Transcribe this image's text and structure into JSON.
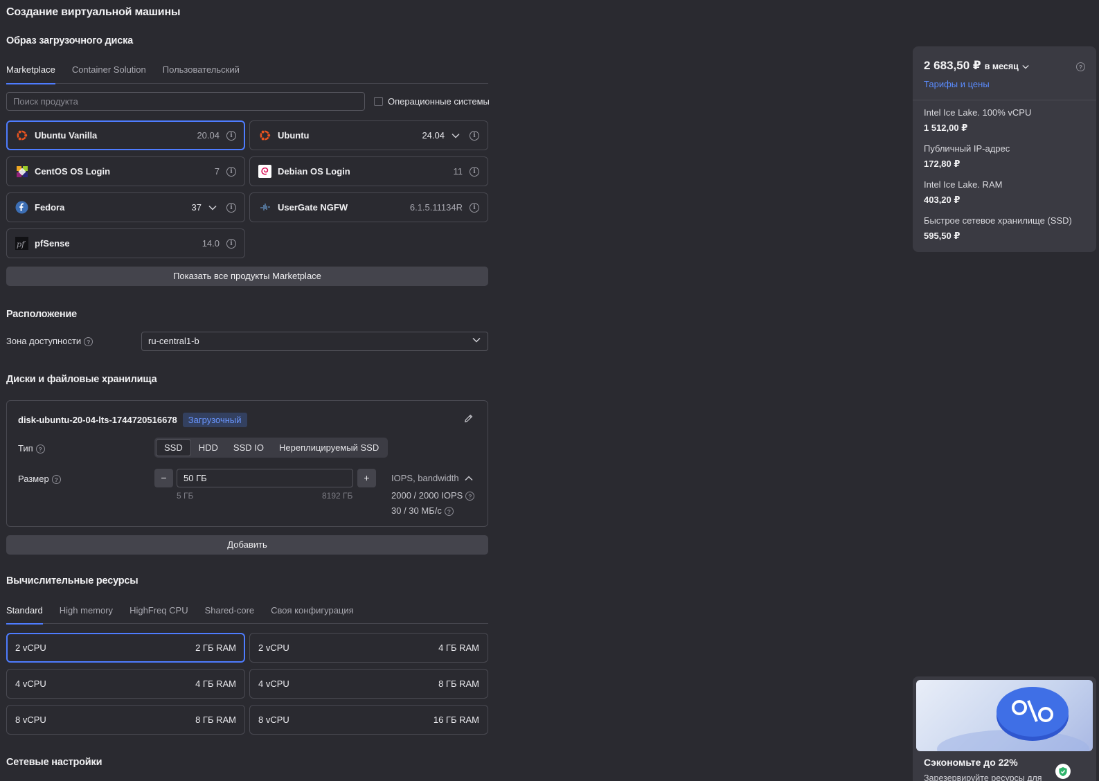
{
  "page_title": "Создание виртуальной машины",
  "boot_disk": {
    "heading": "Образ загрузочного диска",
    "tabs": [
      "Marketplace",
      "Container Solution",
      "Пользовательский"
    ],
    "search_placeholder": "Поиск продукта",
    "os_filter_label": "Операционные системы",
    "products": [
      {
        "name": "Ubuntu Vanilla",
        "version": "20.04",
        "icon": "ubuntu-icon",
        "selected": true,
        "dropdown": false
      },
      {
        "name": "Ubuntu",
        "version": "24.04",
        "icon": "ubuntu-icon",
        "selected": false,
        "dropdown": true
      },
      {
        "name": "CentOS OS Login",
        "version": "7",
        "icon": "centos-icon",
        "selected": false,
        "dropdown": false
      },
      {
        "name": "Debian OS Login",
        "version": "11",
        "icon": "debian-icon",
        "selected": false,
        "dropdown": false
      },
      {
        "name": "Fedora",
        "version": "37",
        "icon": "fedora-icon",
        "selected": false,
        "dropdown": true
      },
      {
        "name": "UserGate NGFW",
        "version": "6.1.5.11134R",
        "icon": "usergate-icon",
        "selected": false,
        "dropdown": false
      },
      {
        "name": "pfSense",
        "version": "14.0",
        "icon": "pfsense-icon",
        "selected": false,
        "dropdown": false
      }
    ],
    "show_all_label": "Показать все продукты Marketplace"
  },
  "location": {
    "heading": "Расположение",
    "zone_label": "Зона доступности",
    "zone_value": "ru-central1-b"
  },
  "disks": {
    "heading": "Диски и файловые хранилища",
    "disk_name": "disk-ubuntu-20-04-lts-1744720516678",
    "badge": "Загрузочный",
    "type_label": "Тип",
    "types": [
      "SSD",
      "HDD",
      "SSD IO",
      "Нереплицируемый SSD"
    ],
    "active_type": "SSD",
    "size_label": "Размер",
    "size_value": "50 ГБ",
    "size_min": "5 ГБ",
    "size_max": "8192 ГБ",
    "minus": "−",
    "plus": "+",
    "iops_toggle": "IOPS, bandwidth",
    "iops": "2000 / 2000 IOPS",
    "bandwidth": "30 / 30 МБ/с",
    "add_label": "Добавить"
  },
  "compute": {
    "heading": "Вычислительные ресурсы",
    "tabs": [
      "Standard",
      "High memory",
      "HighFreq CPU",
      "Shared-core",
      "Своя конфигурация"
    ],
    "configs": [
      {
        "cpu": "2 vCPU",
        "ram": "2 ГБ RAM",
        "selected": true
      },
      {
        "cpu": "2 vCPU",
        "ram": "4 ГБ RAM",
        "selected": false
      },
      {
        "cpu": "4 vCPU",
        "ram": "4 ГБ RAM",
        "selected": false
      },
      {
        "cpu": "4 vCPU",
        "ram": "8 ГБ RAM",
        "selected": false
      },
      {
        "cpu": "8 vCPU",
        "ram": "8 ГБ RAM",
        "selected": false
      },
      {
        "cpu": "8 vCPU",
        "ram": "16 ГБ RAM",
        "selected": false
      }
    ]
  },
  "network": {
    "heading": "Сетевые настройки"
  },
  "price": {
    "total": "2 683,50 ₽",
    "period": "в месяц",
    "tariffs_link": "Тарифы и цены",
    "items": [
      {
        "name": "Intel Ice Lake. 100% vCPU",
        "value": "1 512,00 ₽"
      },
      {
        "name": "Публичный IP-адрес",
        "value": "172,80 ₽"
      },
      {
        "name": "Intel Ice Lake. RAM",
        "value": "403,20 ₽"
      },
      {
        "name": "Быстрое сетевое хранилище (SSD)",
        "value": "595,50 ₽"
      }
    ]
  },
  "promo": {
    "title": "Сэкономьте до 22%",
    "subtitle": "Зарезервируйте ресурсы для"
  },
  "colors": {
    "accent": "#4e7cff",
    "link": "#5b8cff",
    "background": "#2a2a30",
    "panel": "#3a3a42"
  }
}
